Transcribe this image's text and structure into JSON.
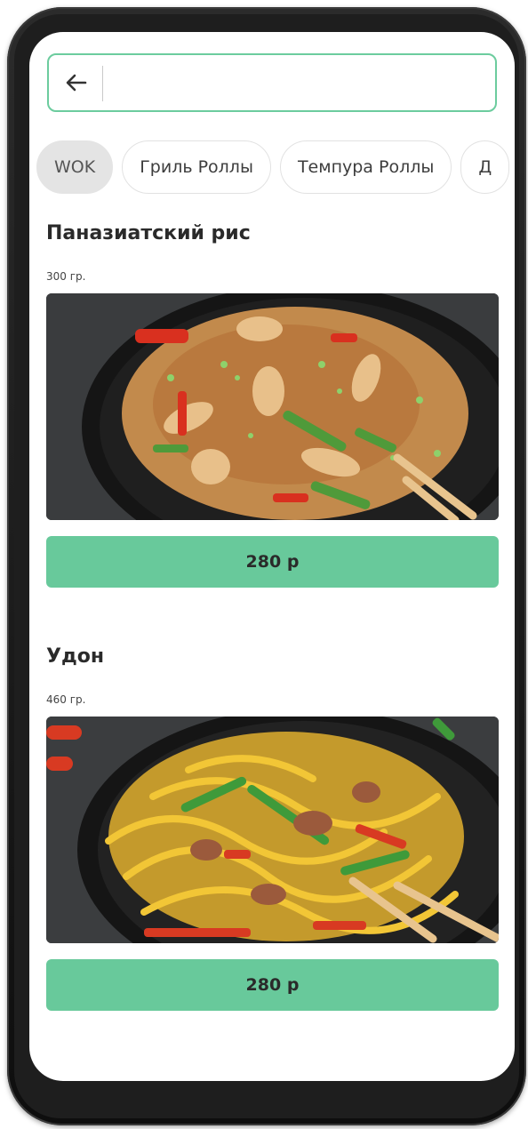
{
  "search": {
    "placeholder": "",
    "value": ""
  },
  "categories": [
    {
      "label": "WOK",
      "active": true
    },
    {
      "label": "Гриль Роллы",
      "active": false
    },
    {
      "label": "Темпура Роллы",
      "active": false
    },
    {
      "label": "Д",
      "active": false
    }
  ],
  "products": [
    {
      "title": "Паназиатский рис",
      "weight": "300 гр.",
      "price": "280 р",
      "image": "fried-rice-photo"
    },
    {
      "title": "Удон",
      "weight": "460 гр.",
      "price": "280 р",
      "image": "udon-noodles-photo"
    }
  ],
  "colors": {
    "accent": "#68c99b",
    "search_border": "#6ccc9e",
    "chip_active_bg": "#e4e4e4"
  }
}
